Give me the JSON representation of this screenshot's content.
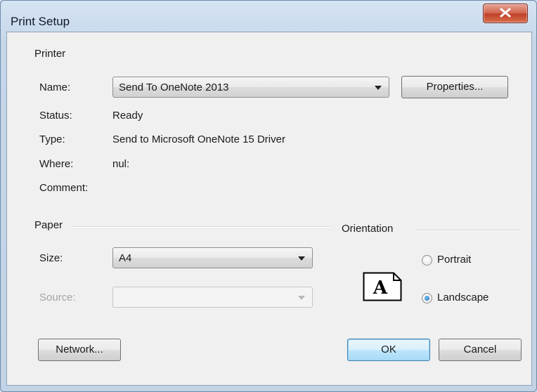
{
  "window": {
    "title": "Print Setup"
  },
  "printer": {
    "group_title": "Printer",
    "name_label": "Name:",
    "name_value": "Send To OneNote 2013",
    "properties_button": "Properties...",
    "status_label": "Status:",
    "status_value": "Ready",
    "type_label": "Type:",
    "type_value": "Send to Microsoft OneNote 15 Driver",
    "where_label": "Where:",
    "where_value": "nul:",
    "comment_label": "Comment:",
    "comment_value": ""
  },
  "paper": {
    "group_title": "Paper",
    "size_label": "Size:",
    "size_value": "A4",
    "source_label": "Source:",
    "source_value": ""
  },
  "orientation": {
    "group_title": "Orientation",
    "portrait_label": "Portrait",
    "landscape_label": "Landscape",
    "selected": "Landscape",
    "icon_letter": "A"
  },
  "buttons": {
    "network": "Network...",
    "ok": "OK",
    "cancel": "Cancel"
  }
}
